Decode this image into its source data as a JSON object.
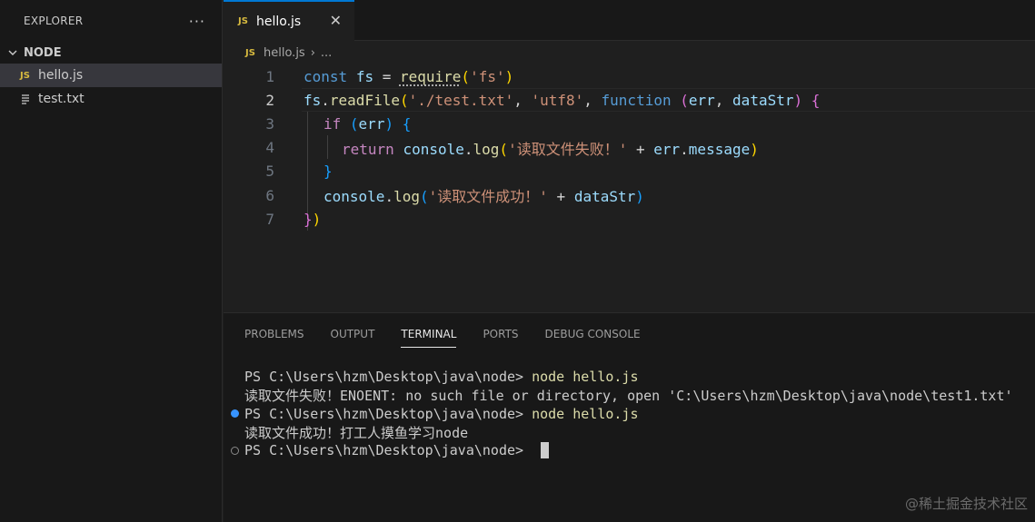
{
  "explorer": {
    "title": "EXPLORER",
    "more": "···",
    "folder": "NODE",
    "files": [
      {
        "name": "hello.js",
        "badge": "JS"
      },
      {
        "name": "test.txt"
      }
    ]
  },
  "editor": {
    "tab": {
      "label": "hello.js",
      "badge": "JS",
      "close": "✕"
    },
    "breadcrumb": {
      "file": "hello.js",
      "rest": "...",
      "badge": "JS"
    },
    "line_numbers": [
      "1",
      "2",
      "3",
      "4",
      "5",
      "6",
      "7"
    ],
    "code": {
      "l1": {
        "kw": "const",
        "var": "fs",
        "op": " = ",
        "fn": "require",
        "p1": "(",
        "str": "'fs'",
        "p2": ")"
      },
      "l2": {
        "obj": "fs",
        "dot": ".",
        "fn": "readFile",
        "p1": "(",
        "s1": "'./test.txt'",
        "c1": ", ",
        "s2": "'utf8'",
        "c2": ", ",
        "kw": "function",
        "sp": " ",
        "p2": "(",
        "a1": "err",
        "c3": ", ",
        "a2": "dataStr",
        "p3": ")",
        "sp2": " ",
        "br": "{"
      },
      "l3": {
        "kw": "if",
        "sp": " ",
        "p1": "(",
        "v": "err",
        "p2": ")",
        "sp2": " ",
        "br": "{"
      },
      "l4": {
        "kw": "return",
        "sp": " ",
        "obj": "console",
        "dot": ".",
        "fn": "log",
        "p1": "(",
        "str": "'读取文件失败！'",
        "op": " + ",
        "v": "err",
        "dot2": ".",
        "prop": "message",
        "p2": ")"
      },
      "l5": {
        "br": "}"
      },
      "l6": {
        "obj": "console",
        "dot": ".",
        "fn": "log",
        "p1": "(",
        "str": "'读取文件成功！'",
        "op": " + ",
        "v": "dataStr",
        "p2": ")"
      },
      "l7": {
        "br": "}",
        "p": ")"
      }
    }
  },
  "panel": {
    "tabs": [
      "PROBLEMS",
      "OUTPUT",
      "TERMINAL",
      "PORTS",
      "DEBUG CONSOLE"
    ],
    "active_tab": "TERMINAL",
    "terminal": [
      {
        "prompt": "PS C:\\Users\\hzm\\Desktop\\java\\node> ",
        "cmd": "node hello.js"
      },
      {
        "text": "读取文件失败！ENOENT: no such file or directory, open 'C:\\Users\\hzm\\Desktop\\java\\node\\test1.txt'"
      },
      {
        "prompt": "PS C:\\Users\\hzm\\Desktop\\java\\node> ",
        "cmd": "node hello.js"
      },
      {
        "text": "读取文件成功！打工人摸鱼学习node"
      },
      {
        "prompt": "PS C:\\Users\\hzm\\Desktop\\java\\node> "
      }
    ]
  },
  "watermark": "@稀土掘金技术社区",
  "colors": {
    "accent": "#0078d4",
    "js_badge": "#d7ba3f",
    "keyword": "#569cd6",
    "string": "#ce9178",
    "function": "#dcdcaa"
  }
}
